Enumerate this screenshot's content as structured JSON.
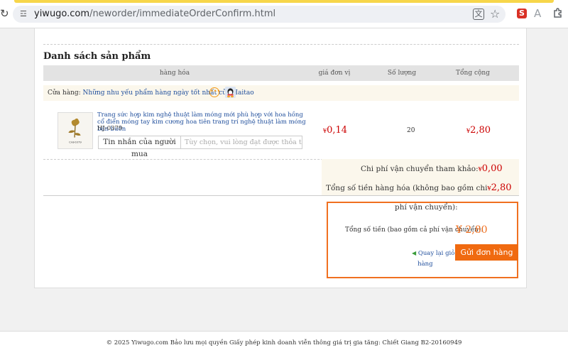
{
  "browser": {
    "url_host": "yiwugo.com",
    "url_path": "/neworder/immediateOrderConfirm.html",
    "ext_s_label": "S",
    "ext_a_label": "A",
    "icons": [
      "reload-icon",
      "site-info-icon",
      "translate-icon",
      "star-icon",
      "extension-s-icon",
      "extension-a-icon",
      "puzzle-icon"
    ],
    "accent_color": "#f7d64a"
  },
  "section": {
    "title": "Danh sách sản phẩm"
  },
  "table": {
    "headers": [
      "hàng hóa",
      "giá đơn vị",
      "Số lượng",
      "Tổng cộng"
    ]
  },
  "store": {
    "prefix": "Cửa hàng:",
    "name": "Những nhu yếu phẩm hàng ngày tốt nhất của Haitao"
  },
  "product": {
    "title": "Trang sức hợp kim nghệ thuật làm móng mới phù hợp với hoa hồng cổ điển móng tay kim cương hoa tiên trang trí nghệ thuật làm móng bán buôn",
    "sku": "HJ-0379",
    "image_caption": "CHJ-0379",
    "message_label": "Tin nhắn của người mua",
    "message_placeholder": "Tùy chọn, vui lòng đạt được thỏa th...",
    "currency": "¥",
    "unit_price": "0,14",
    "quantity": "20",
    "total": "2,80"
  },
  "summary": {
    "shipping_label": "Chi phí vận chuyển tham khảo:",
    "shipping_amount": "0,00",
    "subtotal_label": "Tổng số tiền hàng hóa (không bao gồm chi",
    "subtotal_amount": "2,80",
    "subtotal_wrap": "phí vận chuyển):"
  },
  "order": {
    "grand_label": "Tổng số tiền (bao gồm cả phí vận chuyển):",
    "grand_amount": "2,80",
    "back_line1": "Quay lại giỏ",
    "back_line2": "hàng",
    "submit_label": "Gửi đơn hàng",
    "accent_color": "#f06a10"
  },
  "footer": {
    "text": "© 2025 Yiwugo.com Bảo lưu mọi quyền Giấy phép kinh doanh viễn thông giá trị gia tăng: Chiết Giang B2-20160949"
  }
}
